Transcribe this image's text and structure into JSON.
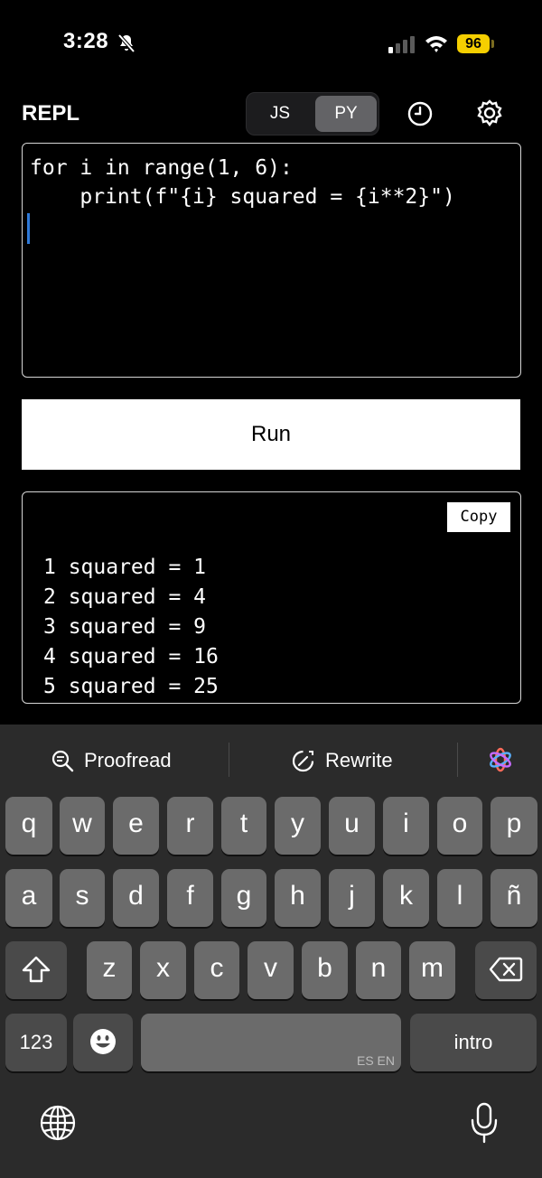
{
  "status_bar": {
    "time": "3:28",
    "battery": "96"
  },
  "header": {
    "title": "REPL",
    "segments": [
      "JS",
      "PY"
    ],
    "selected_segment": "PY"
  },
  "editor": {
    "lines": [
      "for i in range(1, 6):",
      "    print(f\"{i} squared = {i**2}\")"
    ]
  },
  "run_button": {
    "label": "Run"
  },
  "output": {
    "copy_label": "Copy",
    "lines": [
      "1 squared = 1",
      "2 squared = 4",
      "3 squared = 9",
      "4 squared = 16",
      "5 squared = 25"
    ]
  },
  "keyboard": {
    "suggestions": {
      "proofread": "Proofread",
      "rewrite": "Rewrite"
    },
    "row1": [
      "q",
      "w",
      "e",
      "r",
      "t",
      "y",
      "u",
      "i",
      "o",
      "p"
    ],
    "row2": [
      "a",
      "s",
      "d",
      "f",
      "g",
      "h",
      "j",
      "k",
      "l",
      "ñ"
    ],
    "row3": [
      "z",
      "x",
      "c",
      "v",
      "b",
      "n",
      "m"
    ],
    "numbers_key": "123",
    "space_hint": "ES EN",
    "return_key": "intro",
    "icons": [
      "bell-slash-icon",
      "signal-icon",
      "wifi-icon",
      "history-icon",
      "gear-icon",
      "proofread-icon",
      "rewrite-icon",
      "apple-intelligence-icon",
      "shift-icon",
      "backspace-icon",
      "emoji-icon",
      "globe-icon",
      "microphone-icon"
    ]
  }
}
